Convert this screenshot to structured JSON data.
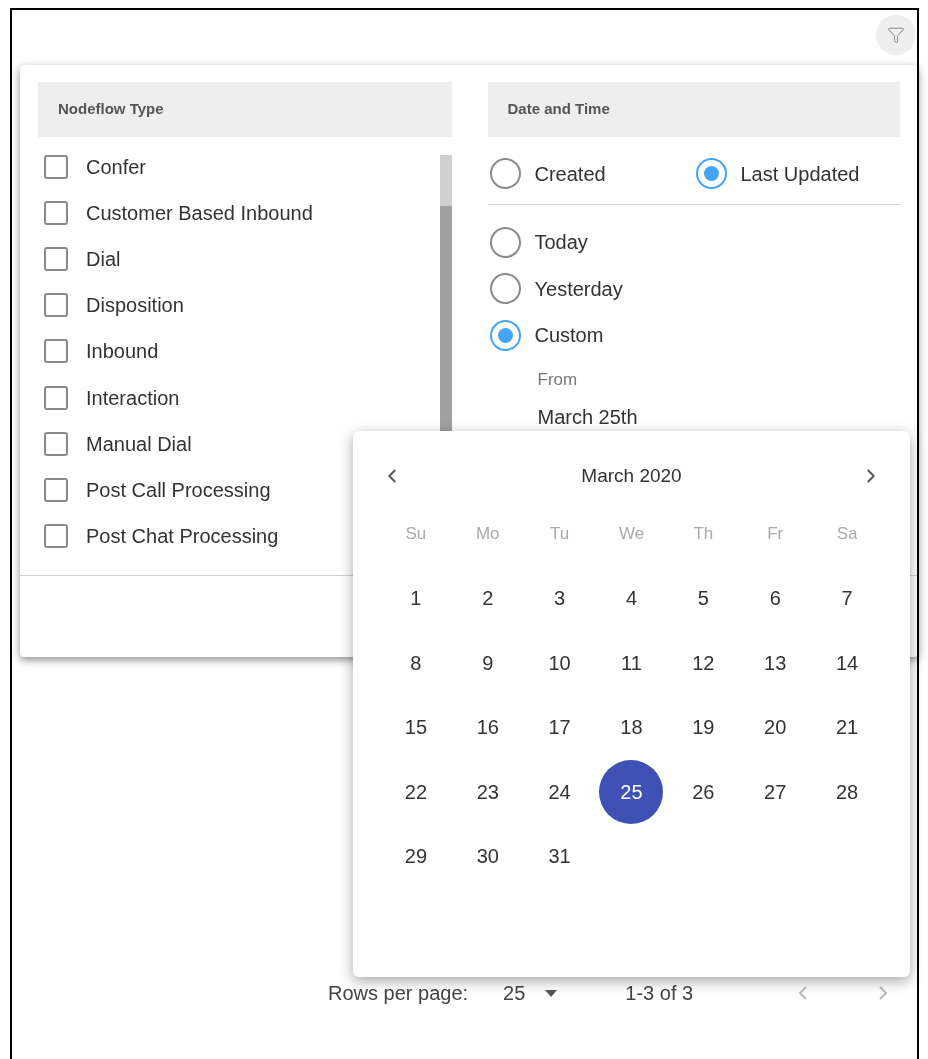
{
  "nodeflow_type": {
    "title": "Nodeflow Type",
    "items": [
      {
        "label": "Confer",
        "checked": false
      },
      {
        "label": "Customer Based Inbound",
        "checked": false
      },
      {
        "label": "Dial",
        "checked": false
      },
      {
        "label": "Disposition",
        "checked": false
      },
      {
        "label": "Inbound",
        "checked": false
      },
      {
        "label": "Interaction",
        "checked": false
      },
      {
        "label": "Manual Dial",
        "checked": false
      },
      {
        "label": "Post Call Processing",
        "checked": false
      },
      {
        "label": "Post Chat Processing",
        "checked": false
      }
    ]
  },
  "date_time": {
    "title": "Date and Time",
    "basis": [
      {
        "label": "Created",
        "selected": false
      },
      {
        "label": "Last Updated",
        "selected": true
      }
    ],
    "ranges": [
      {
        "label": "Today",
        "selected": false
      },
      {
        "label": "Yesterday",
        "selected": false
      },
      {
        "label": "Custom",
        "selected": true
      }
    ],
    "from": {
      "label": "From",
      "value": "March 25th"
    }
  },
  "calendar": {
    "month": "March 2020",
    "weekdays": [
      "Su",
      "Mo",
      "Tu",
      "We",
      "Th",
      "Fr",
      "Sa"
    ],
    "days": [
      {
        "label": "1",
        "selected": false
      },
      {
        "label": "2",
        "selected": false
      },
      {
        "label": "3",
        "selected": false
      },
      {
        "label": "4",
        "selected": false
      },
      {
        "label": "5",
        "selected": false
      },
      {
        "label": "6",
        "selected": false
      },
      {
        "label": "7",
        "selected": false
      },
      {
        "label": "8",
        "selected": false
      },
      {
        "label": "9",
        "selected": false
      },
      {
        "label": "10",
        "selected": false
      },
      {
        "label": "11",
        "selected": false
      },
      {
        "label": "12",
        "selected": false
      },
      {
        "label": "13",
        "selected": false
      },
      {
        "label": "14",
        "selected": false
      },
      {
        "label": "15",
        "selected": false
      },
      {
        "label": "16",
        "selected": false
      },
      {
        "label": "17",
        "selected": false
      },
      {
        "label": "18",
        "selected": false
      },
      {
        "label": "19",
        "selected": false
      },
      {
        "label": "20",
        "selected": false
      },
      {
        "label": "21",
        "selected": false
      },
      {
        "label": "22",
        "selected": false
      },
      {
        "label": "23",
        "selected": false
      },
      {
        "label": "24",
        "selected": false
      },
      {
        "label": "25",
        "selected": true
      },
      {
        "label": "26",
        "selected": false
      },
      {
        "label": "27",
        "selected": false
      },
      {
        "label": "28",
        "selected": false
      },
      {
        "label": "29",
        "selected": false
      },
      {
        "label": "30",
        "selected": false
      },
      {
        "label": "31",
        "selected": false
      }
    ]
  },
  "pagination": {
    "rows_label": "Rows per page:",
    "rows_value": "25",
    "range": "1-3 of 3"
  }
}
